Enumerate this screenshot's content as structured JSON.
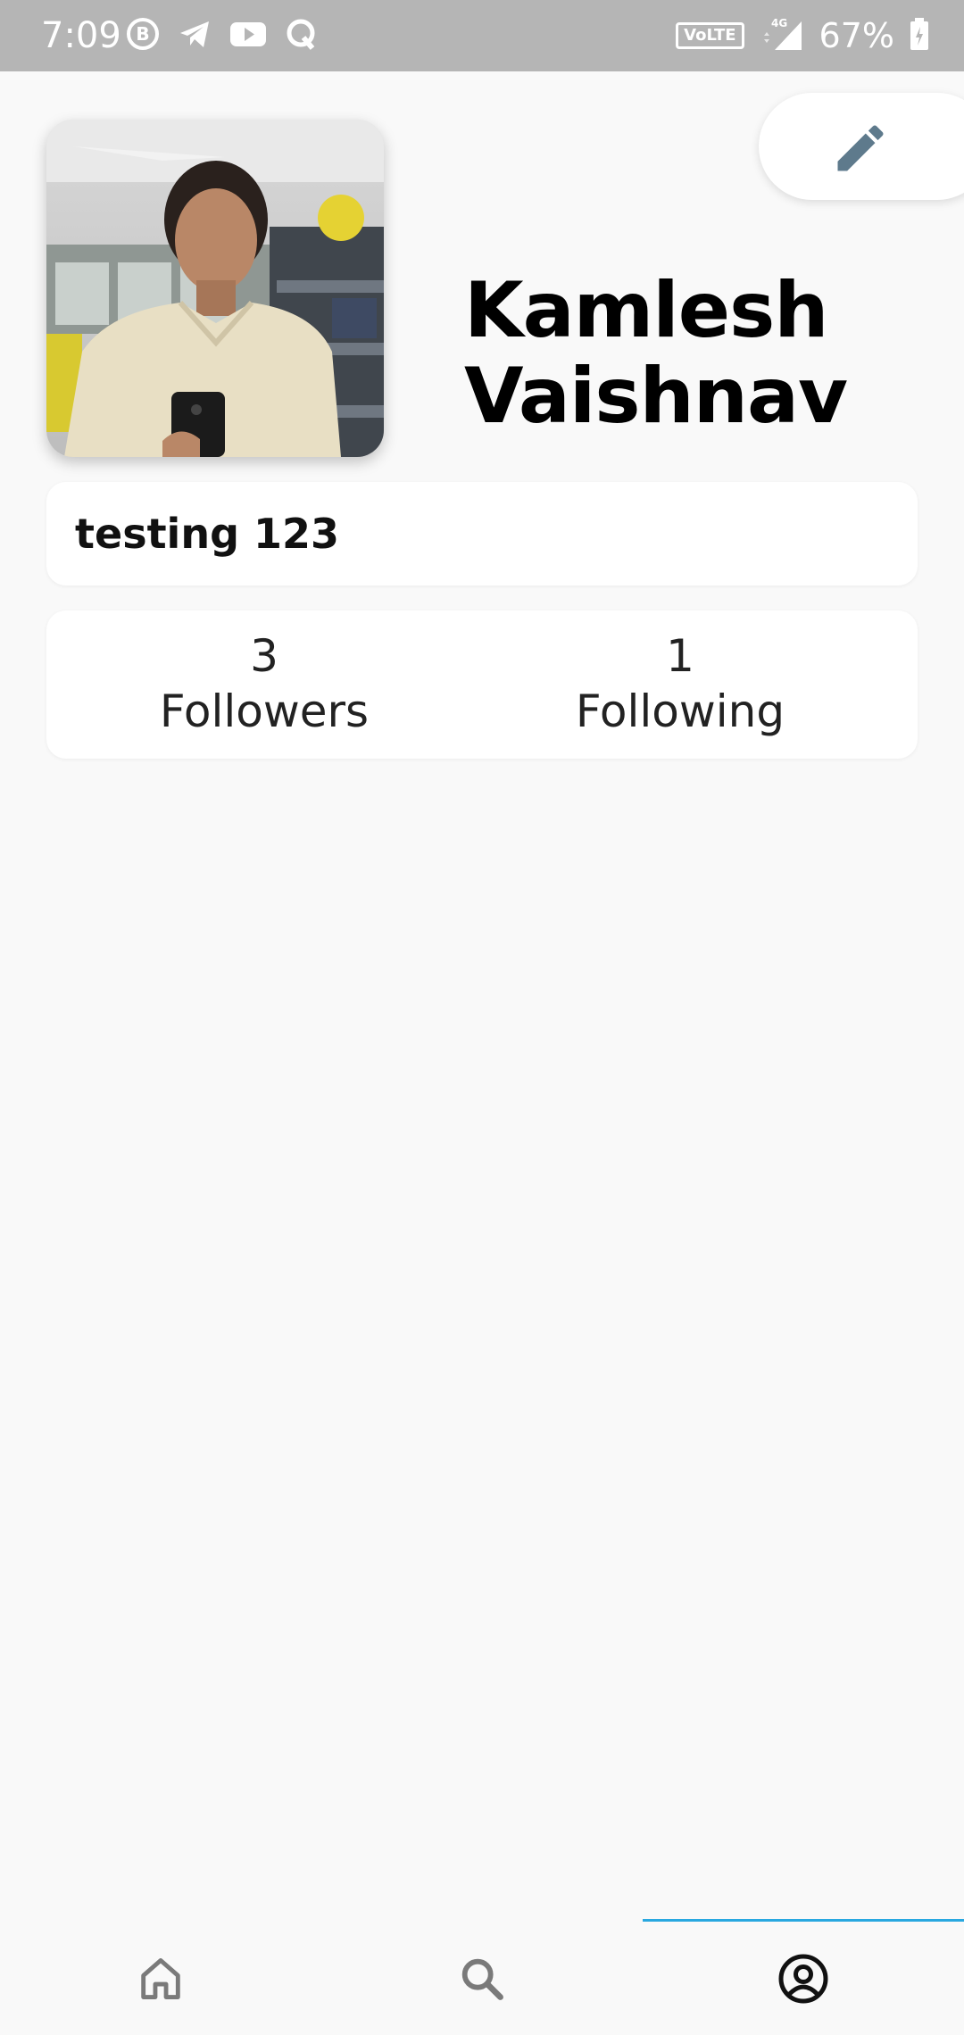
{
  "status_bar": {
    "time": "7:09",
    "battery_percent": "67%",
    "volte_label": "VoLTE",
    "network_label": "4G",
    "left_icons": [
      "b-badge-icon",
      "telegram-icon",
      "youtube-icon",
      "q-icon"
    ]
  },
  "profile": {
    "name": "Kamlesh Vaishnav",
    "bio": "testing 123",
    "followers_count": "3",
    "followers_label": "Followers",
    "following_count": "1",
    "following_label": "Following"
  },
  "edit_button": {
    "icon": "pencil-icon"
  },
  "bottom_nav": {
    "items": [
      {
        "icon": "home-icon",
        "selected": false
      },
      {
        "icon": "search-icon",
        "selected": false
      },
      {
        "icon": "account-icon",
        "selected": true
      }
    ]
  },
  "colors": {
    "status_bar": "#b5b5b5",
    "background": "#f9f9f9",
    "card": "#ffffff",
    "nav_indicator": "#29a8e0",
    "edit_icon": "#5e7a8c",
    "nav_icon": "#7a7a7a",
    "nav_icon_selected": "#111111"
  }
}
